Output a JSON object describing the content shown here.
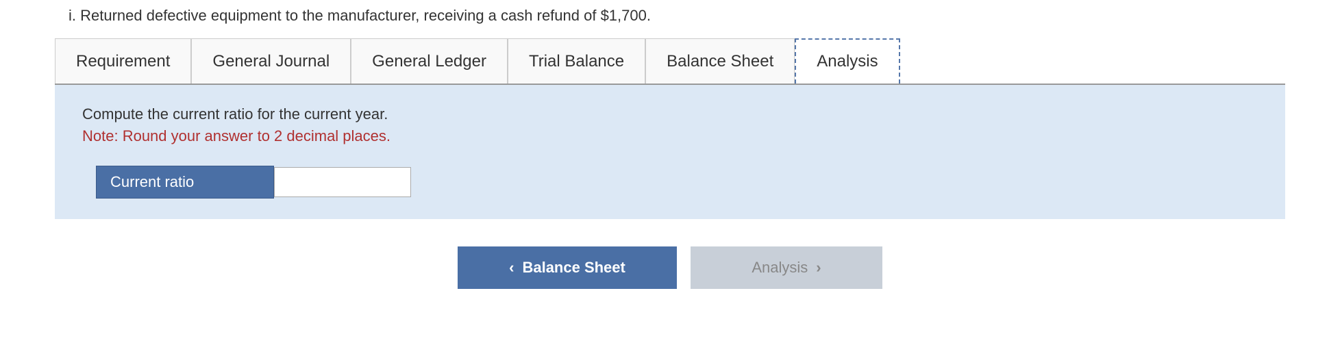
{
  "top_text": "i. Returned defective equipment to the manufacturer, receiving a cash refund of $1,700.",
  "tabs": [
    {
      "id": "requirement",
      "label": "Requirement",
      "active": false,
      "dashed": false
    },
    {
      "id": "general-journal",
      "label": "General Journal",
      "active": false,
      "dashed": false
    },
    {
      "id": "general-ledger",
      "label": "General Ledger",
      "active": false,
      "dashed": false
    },
    {
      "id": "trial-balance",
      "label": "Trial Balance",
      "active": false,
      "dashed": false
    },
    {
      "id": "balance-sheet",
      "label": "Balance Sheet",
      "active": false,
      "dashed": false
    },
    {
      "id": "analysis",
      "label": "Analysis",
      "active": true,
      "dashed": true
    }
  ],
  "content": {
    "instruction": "Compute the current ratio for the current year.",
    "note": "Note: Round your answer to 2 decimal places.",
    "current_ratio_label": "Current ratio",
    "current_ratio_value": "",
    "current_ratio_placeholder": ""
  },
  "buttons": {
    "back_label": "Balance Sheet",
    "back_chevron": "‹",
    "next_label": "Analysis",
    "next_chevron": "›"
  }
}
